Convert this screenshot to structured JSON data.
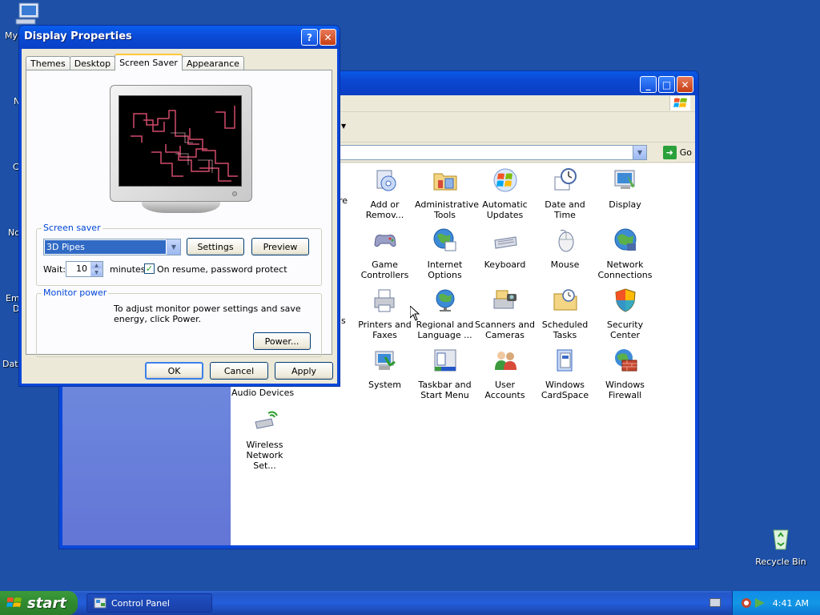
{
  "desktop": {
    "partial_labels": [
      "My",
      "N",
      "C",
      "Nc",
      "Em",
      "D",
      "Data"
    ],
    "recycle_bin": "Recycle Bin"
  },
  "control_panel": {
    "go_label": "Go",
    "partial_left_labels": [
      "re",
      "ns"
    ],
    "partial_audio": "Audio Devices",
    "icons": [
      {
        "label": "Add or\nRemov...",
        "icon": "add-remove-icon"
      },
      {
        "label": "Administrative\nTools",
        "icon": "admin-tools-icon"
      },
      {
        "label": "Automatic\nUpdates",
        "icon": "auto-updates-icon"
      },
      {
        "label": "Date and Time",
        "icon": "clock-icon"
      },
      {
        "label": "Display",
        "icon": "display-icon"
      },
      {
        "label": "Game\nControllers",
        "icon": "gamepad-icon"
      },
      {
        "label": "Internet\nOptions",
        "icon": "internet-icon"
      },
      {
        "label": "Keyboard",
        "icon": "keyboard-icon"
      },
      {
        "label": "Mouse",
        "icon": "mouse-icon"
      },
      {
        "label": "Network\nConnections",
        "icon": "network-icon"
      },
      {
        "label": "Printers and\nFaxes",
        "icon": "printer-icon"
      },
      {
        "label": "Regional and\nLanguage ...",
        "icon": "globe-icon"
      },
      {
        "label": "Scanners and\nCameras",
        "icon": "scanner-icon"
      },
      {
        "label": "Scheduled\nTasks",
        "icon": "tasks-folder-icon"
      },
      {
        "label": "Security\nCenter",
        "icon": "shield-icon"
      },
      {
        "label": "System",
        "icon": "system-icon"
      },
      {
        "label": "Taskbar and\nStart Menu",
        "icon": "taskbar-icon"
      },
      {
        "label": "User Accounts",
        "icon": "users-icon"
      },
      {
        "label": "Windows\nCardSpace",
        "icon": "cardspace-icon"
      },
      {
        "label": "Windows\nFirewall",
        "icon": "firewall-icon"
      },
      {
        "label": "Wireless\nNetwork Set...",
        "icon": "wireless-icon"
      }
    ]
  },
  "dialog": {
    "title": "Display Properties",
    "tabs": [
      "Themes",
      "Desktop",
      "Screen Saver",
      "Appearance"
    ],
    "active_tab": "Screen Saver",
    "screensaver_group": "Screen saver",
    "screensaver_value": "3D Pipes",
    "settings_label": "Settings",
    "preview_label": "Preview",
    "wait_label": "Wait:",
    "wait_value": "10",
    "minutes_label": "minutes",
    "password_checked": true,
    "password_label": "On resume, password protect",
    "power_group": "Monitor power",
    "power_text": "To adjust monitor power settings and save energy, click Power.",
    "power_button": "Power...",
    "ok_label": "OK",
    "cancel_label": "Cancel",
    "apply_label": "Apply"
  },
  "taskbar": {
    "start_label": "start",
    "task_label": "Control Panel",
    "clock": "4:41 AM"
  },
  "colors": {
    "desktop": "#1d50a6",
    "titlebar": "#0a4bd6",
    "dialog_face": "#ece9d8",
    "group_label": "#0046d5"
  }
}
